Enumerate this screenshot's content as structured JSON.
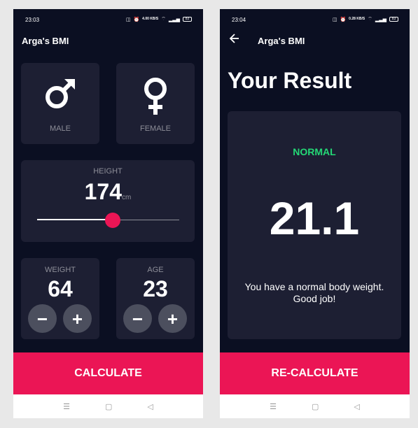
{
  "colors": {
    "background": "#0b0f22",
    "card": "#1d1f33",
    "accent": "#eb1555",
    "label": "#8d8e98",
    "button": "#4c4f5e",
    "normal": "#24d876"
  },
  "input_screen": {
    "status": {
      "time": "23:03",
      "net_speed": "4.00 KB/S",
      "battery": "83"
    },
    "title": "Arga's BMI",
    "gender": {
      "male_label": "MALE",
      "female_label": "FEMALE",
      "male_icon": "male-symbol-icon",
      "female_icon": "female-symbol-icon"
    },
    "height": {
      "label": "HEIGHT",
      "value": "174",
      "unit": "cm",
      "slider_fraction": 0.53
    },
    "weight": {
      "label": "WEIGHT",
      "value": "64",
      "minus": "−",
      "plus": "+"
    },
    "age": {
      "label": "AGE",
      "value": "23",
      "minus": "−",
      "plus": "+"
    },
    "button_label": "CALCULATE",
    "nav": {
      "menu": "☰",
      "home": "▢",
      "back": "◁"
    }
  },
  "result_screen": {
    "status": {
      "time": "23:04",
      "net_speed": "0.28 KB/S",
      "battery": "83"
    },
    "title": "Arga's BMI",
    "back_icon": "arrow-left-icon",
    "heading": "Your Result",
    "result_status": "NORMAL",
    "bmi": "21.1",
    "message": "You have a normal body weight. Good job!",
    "button_label": "RE-CALCULATE",
    "nav": {
      "menu": "☰",
      "home": "▢",
      "back": "◁"
    }
  }
}
